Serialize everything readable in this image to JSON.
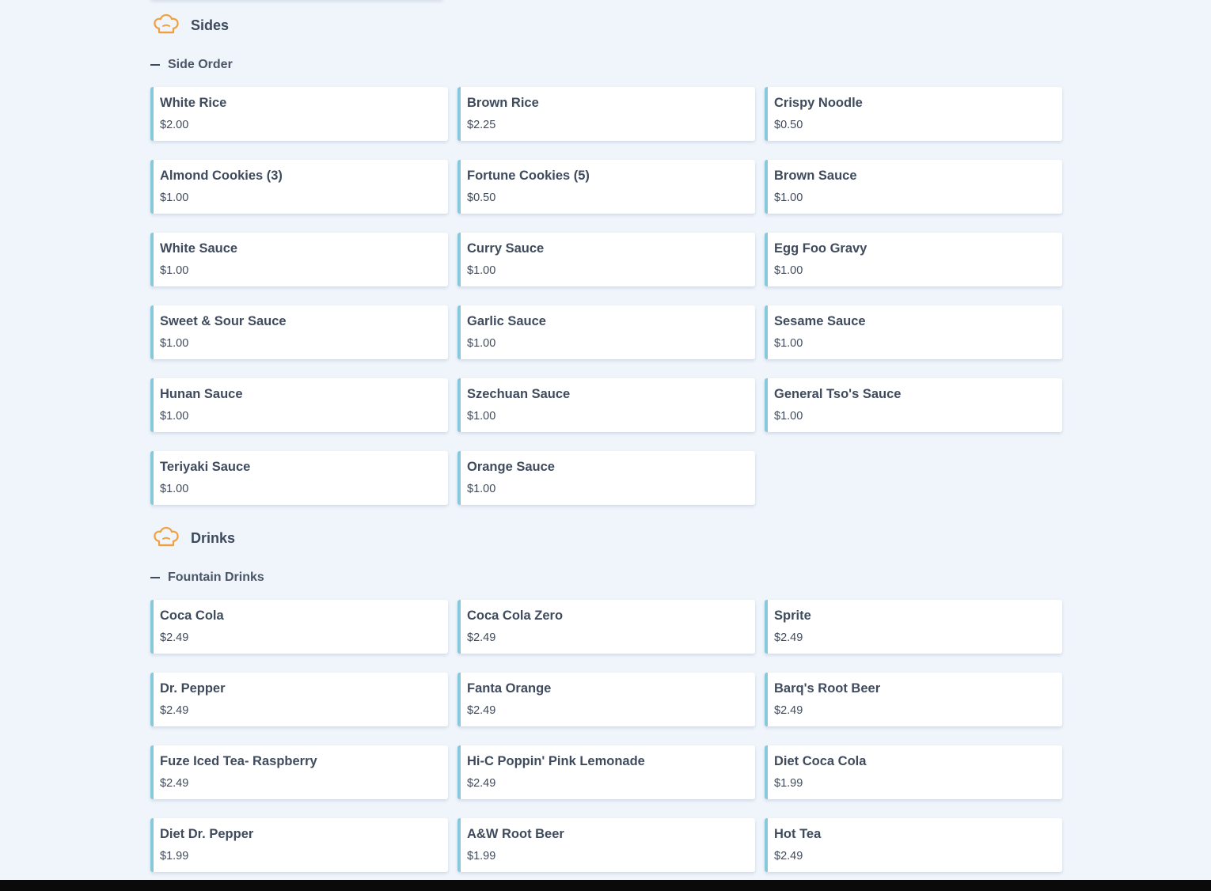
{
  "categories": [
    {
      "title": "Sides",
      "icon": "chef-hat-icon",
      "subcategory": "Side Order",
      "items": [
        {
          "name": "White Rice",
          "price": "$2.00"
        },
        {
          "name": "Brown Rice",
          "price": "$2.25"
        },
        {
          "name": "Crispy Noodle",
          "price": "$0.50"
        },
        {
          "name": "Almond Cookies (3)",
          "price": "$1.00"
        },
        {
          "name": "Fortune Cookies (5)",
          "price": "$0.50"
        },
        {
          "name": "Brown Sauce",
          "price": "$1.00"
        },
        {
          "name": "White Sauce",
          "price": "$1.00"
        },
        {
          "name": "Curry Sauce",
          "price": "$1.00"
        },
        {
          "name": "Egg Foo Gravy",
          "price": "$1.00"
        },
        {
          "name": "Sweet & Sour Sauce",
          "price": "$1.00"
        },
        {
          "name": "Garlic Sauce",
          "price": "$1.00"
        },
        {
          "name": "Sesame Sauce",
          "price": "$1.00"
        },
        {
          "name": "Hunan Sauce",
          "price": "$1.00"
        },
        {
          "name": "Szechuan Sauce",
          "price": "$1.00"
        },
        {
          "name": "General Tso's Sauce",
          "price": "$1.00"
        },
        {
          "name": "Teriyaki Sauce",
          "price": "$1.00"
        },
        {
          "name": "Orange Sauce",
          "price": "$1.00"
        }
      ]
    },
    {
      "title": "Drinks",
      "icon": "chef-hat-icon",
      "subcategory": "Fountain Drinks",
      "items": [
        {
          "name": "Coca Cola",
          "price": "$2.49"
        },
        {
          "name": "Coca Cola Zero",
          "price": "$2.49"
        },
        {
          "name": "Sprite",
          "price": "$2.49"
        },
        {
          "name": "Dr. Pepper",
          "price": "$2.49"
        },
        {
          "name": "Fanta Orange",
          "price": "$2.49"
        },
        {
          "name": "Barq's Root Beer",
          "price": "$2.49"
        },
        {
          "name": "Fuze Iced Tea- Raspberry",
          "price": "$2.49"
        },
        {
          "name": "Hi-C Poppin' Pink Lemonade",
          "price": "$2.49"
        },
        {
          "name": "Diet Coca Cola",
          "price": "$1.99"
        },
        {
          "name": "Diet Dr. Pepper",
          "price": "$1.99"
        },
        {
          "name": "A&W Root Beer",
          "price": "$1.99"
        },
        {
          "name": "Hot Tea",
          "price": "$2.49"
        }
      ]
    }
  ],
  "colors": {
    "background": "#f0f5fc",
    "card": "#ffffff",
    "card_accent": "#86c8dc",
    "icon_orange": "#f0a040",
    "text": "#3f4b5c"
  }
}
